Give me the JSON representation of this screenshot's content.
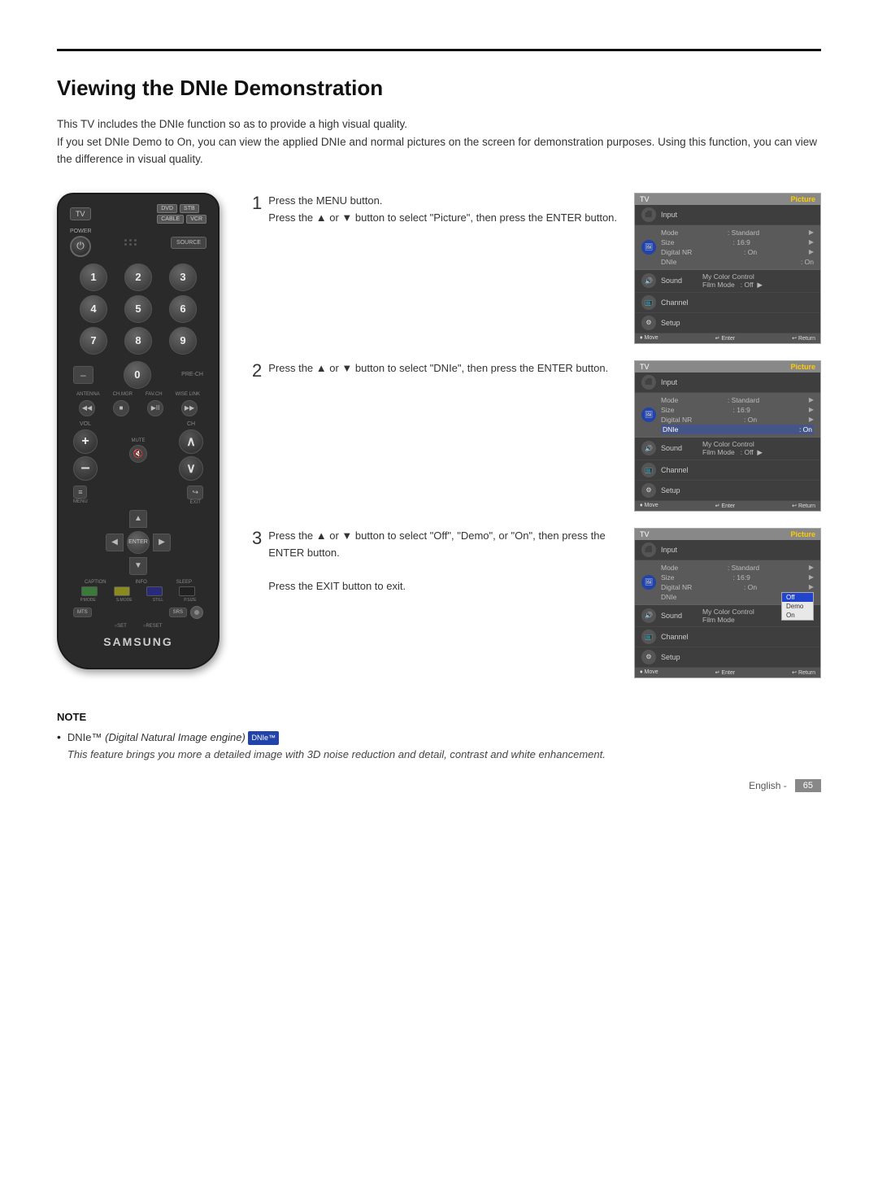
{
  "page": {
    "title": "Viewing the DNIe Demonstration",
    "intro_line1": "This TV includes the DNIe function so as to provide a high visual quality.",
    "intro_line2": "If you set DNIe Demo to On, you can view the applied DNIe and normal pictures on the screen for demonstration purposes. Using this function, you can view the difference in visual quality."
  },
  "steps": [
    {
      "number": "1",
      "text": "Press the MENU button.\nPress the ▲ or ▼ button to select \"Picture\", then press the ENTER button."
    },
    {
      "number": "2",
      "text": "Press the ▲ or ▼ button to select \"DNIe\", then press the ENTER button."
    },
    {
      "number": "3",
      "text": "Press the ▲ or ▼ button to select \"Off\", \"Demo\", or \"On\", then press the ENTER button.",
      "extra": "Press the EXIT button to exit."
    }
  ],
  "tv_screens": [
    {
      "header_left": "TV",
      "header_right": "Picture",
      "menu_items": [
        {
          "label": "Input",
          "rows": []
        },
        {
          "label": "Picture",
          "active": true,
          "rows": [
            {
              "key": "Mode",
              "val": ": Standard",
              "arrow": true
            },
            {
              "key": "Size",
              "val": ": 16:9",
              "arrow": true
            },
            {
              "key": "Digital NR",
              "val": ": On",
              "arrow": true
            },
            {
              "key": "DNIe",
              "val": ": On",
              "arrow": false
            }
          ]
        },
        {
          "label": "Sound",
          "rows": []
        },
        {
          "label": "Channel",
          "rows": []
        },
        {
          "label": "Setup",
          "rows": []
        }
      ],
      "extra_rows": [
        {
          "key": "My Color Control",
          "arrow": true
        },
        {
          "key": "Film Mode",
          "val": ": Off",
          "arrow": true
        }
      ],
      "footer": [
        "♦ Move",
        "↵ Enter",
        "↩ Return"
      ]
    },
    {
      "header_left": "TV",
      "header_right": "Picture",
      "menu_items": [
        {
          "label": "Input",
          "rows": []
        },
        {
          "label": "Picture",
          "active": true,
          "rows": [
            {
              "key": "Mode",
              "val": ": Standard",
              "arrow": true
            },
            {
              "key": "Size",
              "val": ": 16:9",
              "arrow": true
            },
            {
              "key": "Digital NR",
              "val": ": On",
              "arrow": true
            },
            {
              "key": "DNIe",
              "val": ": On",
              "arrow": false,
              "highlighted": true
            }
          ]
        },
        {
          "label": "Sound",
          "rows": []
        },
        {
          "label": "Channel",
          "rows": []
        },
        {
          "label": "Setup",
          "rows": []
        }
      ],
      "extra_rows": [
        {
          "key": "My Color Control",
          "arrow": true
        },
        {
          "key": "Film Mode",
          "val": ": Off",
          "arrow": true
        }
      ],
      "footer": [
        "♦ Move",
        "↵ Enter",
        "↩ Return"
      ]
    },
    {
      "header_left": "TV",
      "header_right": "Picture",
      "menu_items": [
        {
          "label": "Input",
          "rows": []
        },
        {
          "label": "Picture",
          "active": true,
          "rows": [
            {
              "key": "Mode",
              "val": ": Standard",
              "arrow": true
            },
            {
              "key": "Size",
              "val": ": 16:9",
              "arrow": true
            },
            {
              "key": "Digital NR",
              "val": ": On",
              "arrow": true
            },
            {
              "key": "DNIe",
              "val": "",
              "arrow": false
            }
          ]
        },
        {
          "label": "Sound",
          "rows": []
        },
        {
          "label": "Channel",
          "rows": []
        },
        {
          "label": "Setup",
          "rows": []
        }
      ],
      "extra_rows": [
        {
          "key": "My Color Control",
          "arrow": true
        },
        {
          "key": "Film Mode",
          "arrow": false
        }
      ],
      "dropdown": [
        "Off",
        "Demo",
        "On"
      ],
      "dropdown_selected": "Off",
      "footer": [
        "♦ Move",
        "↵ Enter",
        "↩ Return"
      ]
    }
  ],
  "note": {
    "title": "NOTE",
    "bullet": "DNIe™ (Digital Natural Image engine)",
    "badge": "DNIe™",
    "italic_text": "This feature brings you more a detailed image with 3D noise reduction and detail, contrast and white enhancement."
  },
  "footer": {
    "text": "English -",
    "page_number": "65"
  },
  "remote": {
    "samsung_label": "SAMSUNG",
    "tv_label": "TV",
    "dvd_label": "DVD",
    "stb_label": "STB",
    "cable_label": "CABLE",
    "vcr_label": "VCR"
  }
}
